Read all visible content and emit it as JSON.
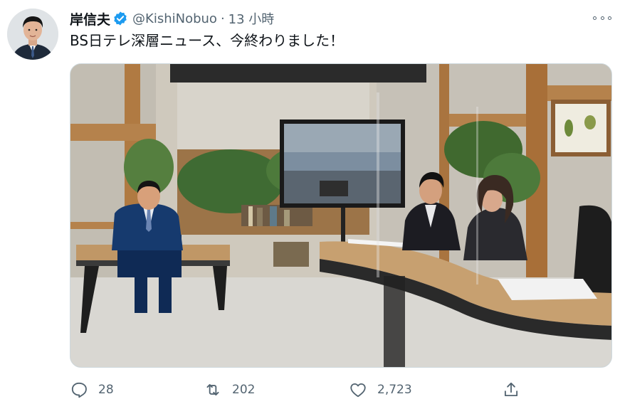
{
  "tweet": {
    "author_name": "岸信夫",
    "handle": "@KishiNobuo",
    "separator": "·",
    "timestamp": "13 小時",
    "text": "BS日テレ深層ニュース、今終わりました！",
    "verified": true,
    "accent_color": "#1d9bf0"
  },
  "actions": {
    "reply_count": "28",
    "retweet_count": "202",
    "like_count": "2,723"
  },
  "icons": {
    "verified": "verified-badge-icon",
    "more": "more-horizontal-icon",
    "reply": "reply-icon",
    "retweet": "retweet-icon",
    "like": "heart-icon",
    "share": "share-icon"
  }
}
